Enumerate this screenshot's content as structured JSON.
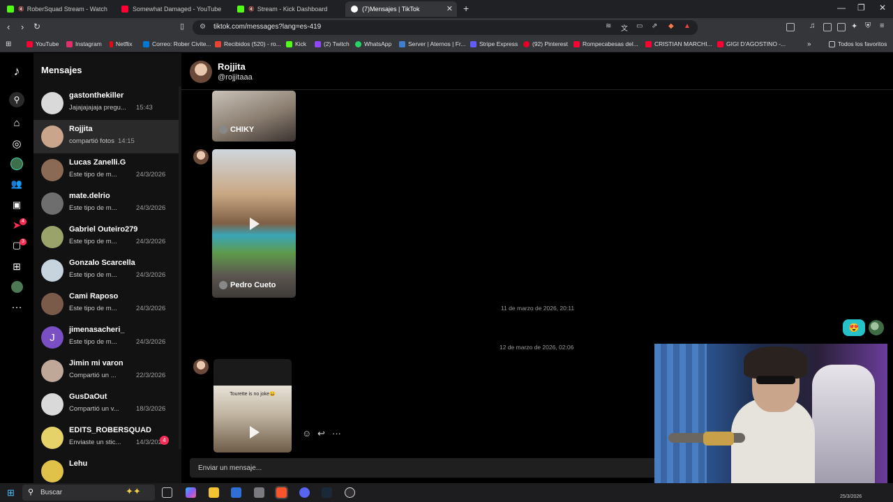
{
  "browser": {
    "tabs": [
      {
        "title": "RoberSquad Stream - Watch Live",
        "color": "#53fc18"
      },
      {
        "title": "Somewhat Damaged - YouTube",
        "color": "#ff0033"
      },
      {
        "title": "Stream - Kick Dashboard",
        "color": "#53fc18"
      },
      {
        "title": "(7)Mensajes | TikTok",
        "color": "#ffffff"
      }
    ],
    "new_tab_icon": "plus-icon",
    "url": "tiktok.com/messages?lang=es-419",
    "bookmarks": [
      {
        "label": "YouTube",
        "color": "#ff0033"
      },
      {
        "label": "Instagram",
        "color": "#e1306c"
      },
      {
        "label": "Netflix",
        "color": "#e50914"
      },
      {
        "label": "Correo: Rober Civite...",
        "color": "#0078d4"
      },
      {
        "label": "Recibidos (520) - ro...",
        "color": "#ea4335"
      },
      {
        "label": "Kick",
        "color": "#53fc18"
      },
      {
        "label": "(2) Twitch",
        "color": "#9146ff"
      },
      {
        "label": "WhatsApp",
        "color": "#25d366"
      },
      {
        "label": "Server | Aternos | Fr...",
        "color": "#3f7fd0"
      },
      {
        "label": "Stripe Express",
        "color": "#635bff"
      },
      {
        "label": "(92) Pinterest",
        "color": "#e60023"
      },
      {
        "label": "Rompecabesas del...",
        "color": "#ff0033"
      },
      {
        "label": "CRISTIAN MARCHI...",
        "color": "#ff0033"
      },
      {
        "label": "GIGI D'AGOSTINO -...",
        "color": "#ff0033"
      }
    ],
    "all_favorites": "Todos los favoritos"
  },
  "tiktok": {
    "rail_badges": {
      "inbox": "4",
      "messages": "3"
    },
    "messages_title": "Mensajes",
    "conversations": [
      {
        "name": "gastonthekiller",
        "preview": "Jajajajajaja pregu...",
        "time": "15:43",
        "avatar": "#d9d9d9"
      },
      {
        "name": "Rojjita",
        "preview": "compartió fotos",
        "time": "14:15",
        "avatar": "#c9a58c",
        "selected": true
      },
      {
        "name": "Lucas Zanelli.G",
        "preview": "Este tipo de m...",
        "time": "24/3/2026",
        "avatar": "#8a6a55"
      },
      {
        "name": "mate.delrio",
        "preview": "Este tipo de m...",
        "time": "24/3/2026",
        "avatar": "#6e6e6e"
      },
      {
        "name": "Gabriel Outeiro279",
        "preview": "Este tipo de m...",
        "time": "24/3/2026",
        "avatar": "#9aa36a"
      },
      {
        "name": "Gonzalo Scarcella",
        "preview": "Este tipo de m...",
        "time": "24/3/2026",
        "avatar": "#c7d4de"
      },
      {
        "name": "Cami Raposo",
        "preview": "Este tipo de m...",
        "time": "24/3/2026",
        "avatar": "#7a5a48"
      },
      {
        "name": "jimenasacheri_",
        "preview": "Este tipo de m...",
        "time": "24/3/2026",
        "avatar": "#7b4fc4",
        "initial": "J"
      },
      {
        "name": "Jimin mi varon",
        "preview": "Compartió un ...",
        "time": "22/3/2026",
        "avatar": "#bfa898"
      },
      {
        "name": "GusDaOut",
        "preview": "Compartió un v...",
        "time": "18/3/2026",
        "avatar": "#d9d9d9"
      },
      {
        "name": "EDITS_ROBERSQUAD",
        "preview": "Enviaste un stic...",
        "time": "14/3/2026",
        "avatar": "#e5d36a",
        "unread": "4"
      },
      {
        "name": "Lehu",
        "preview": "",
        "time": "",
        "avatar": "#e0c24a"
      }
    ],
    "chat": {
      "name": "Rojjita",
      "handle": "@rojjitaaa",
      "media": [
        {
          "label": "CHIKY"
        },
        {
          "label": "Pedro Cueto"
        },
        {
          "caption": "Tourette is no joke😀"
        }
      ],
      "date_separators": [
        "11 de marzo de 2026, 20:11",
        "12 de marzo de 2026, 02:06"
      ],
      "sent_emoji": "😍",
      "composer_placeholder": "Enviar un mensaje..."
    }
  },
  "taskbar": {
    "search_label": "Buscar",
    "clock": "25/3/2026"
  }
}
